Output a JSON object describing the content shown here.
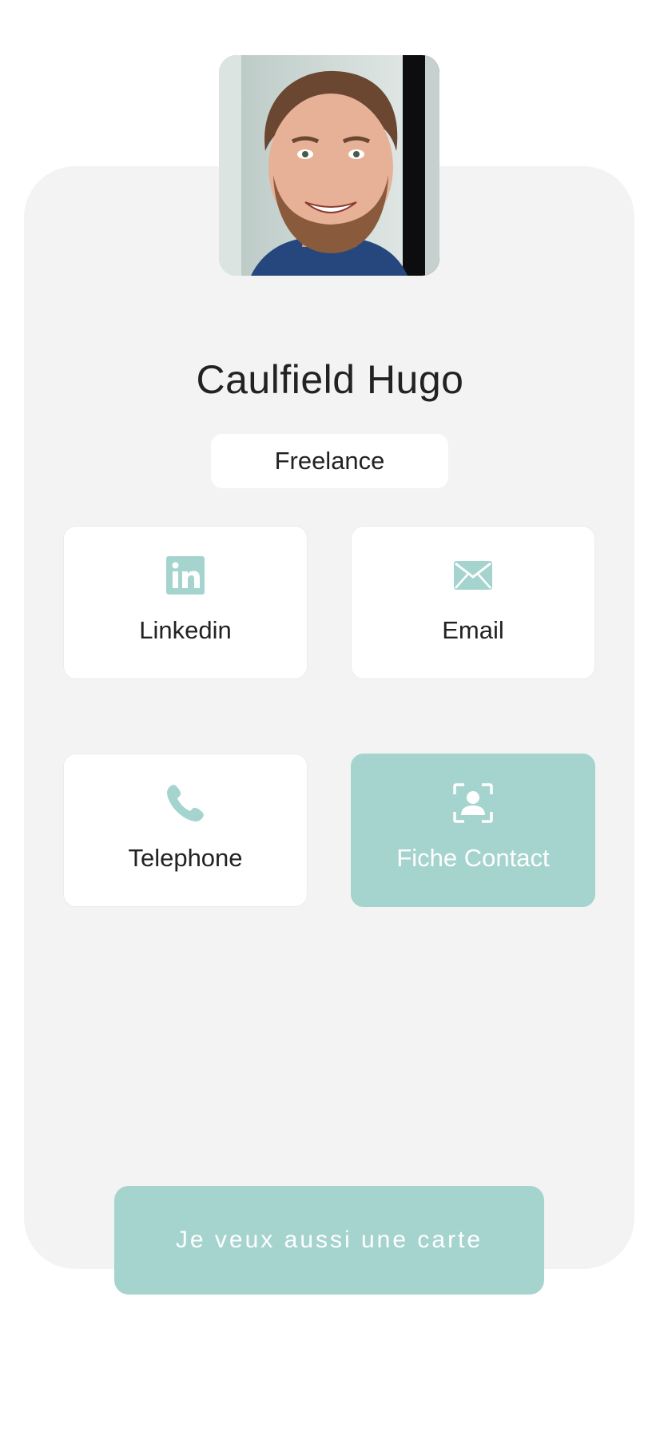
{
  "profile": {
    "name": "Caulfield Hugo",
    "tag": "Freelance"
  },
  "actions": [
    {
      "label": "Linkedin",
      "icon": "linkedin-icon"
    },
    {
      "label": "Email",
      "icon": "mail-icon"
    },
    {
      "label": "Telephone",
      "icon": "phone-icon"
    },
    {
      "label": "Fiche Contact",
      "icon": "contact-card-icon"
    }
  ],
  "cta": {
    "label": "Je veux aussi une carte"
  },
  "colors": {
    "accent": "#a5d4cf",
    "card_background": "#f3f3f3",
    "text": "#222222"
  }
}
